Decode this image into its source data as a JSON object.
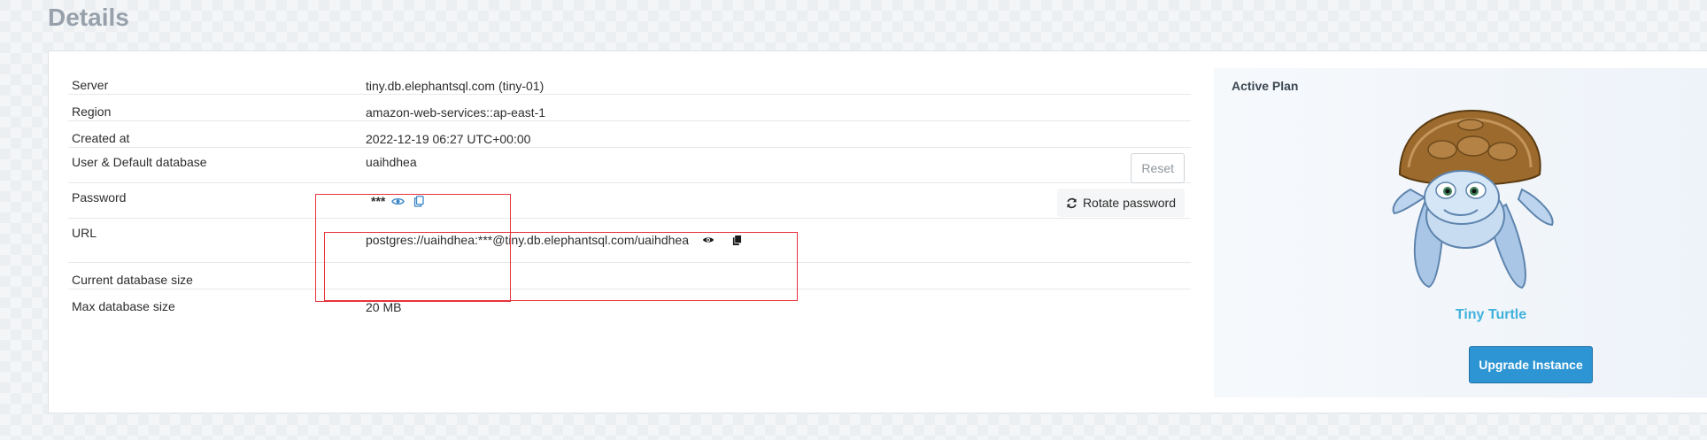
{
  "page": {
    "title": "Details"
  },
  "details": {
    "rows": [
      {
        "label": "Server",
        "value": "tiny.db.elephantsql.com (tiny-01)"
      },
      {
        "label": "Region",
        "value": "amazon-web-services::ap-east-1"
      },
      {
        "label": "Created at",
        "value": "2022-12-19 06:27 UTC+00:00"
      },
      {
        "label": "User & Default database",
        "value": "uaihdhea"
      },
      {
        "label": "Password",
        "value": "***"
      },
      {
        "label": "URL",
        "value": "postgres://uaihdhea:***@tiny.db.elephantsql.com/uaihdhea"
      },
      {
        "label": "Current database size",
        "value": ""
      },
      {
        "label": "Max database size",
        "value": "20 MB"
      }
    ],
    "reset_label": "Reset",
    "rotate_password_label": "Rotate password"
  },
  "plan": {
    "heading": "Active Plan",
    "name": "Tiny Turtle",
    "upgrade_label": "Upgrade Instance"
  },
  "colors": {
    "heading": "#97a1ab",
    "plan_name": "#41b2dc",
    "upgrade_button": "#2d95d3",
    "annotation_box": "#e8333b",
    "password_icon": "#3a86c8"
  },
  "icons": {
    "password_reveal": "eye-icon",
    "password_copy": "copy-icon",
    "url_reveal": "eye-icon",
    "url_copy": "copy-icon",
    "rotate": "refresh-icon"
  }
}
